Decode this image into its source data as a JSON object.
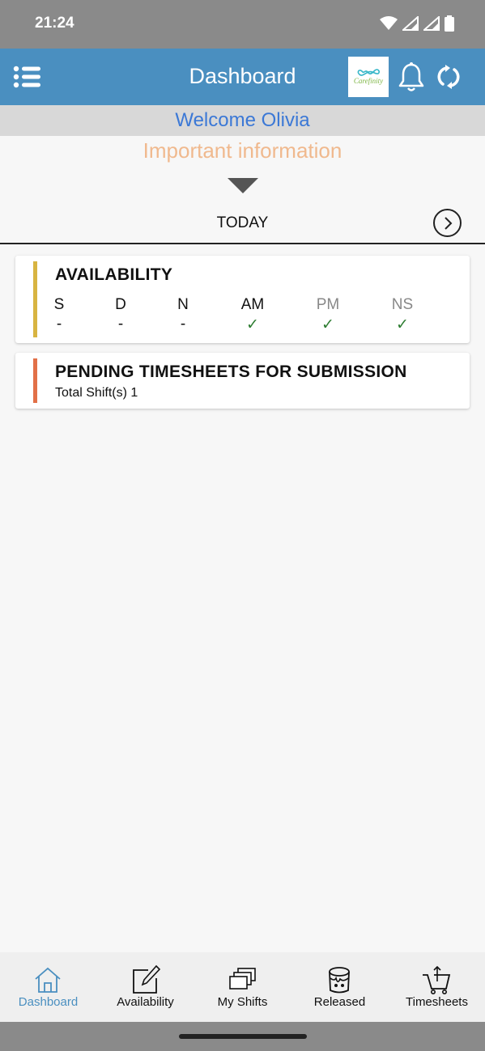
{
  "status_bar": {
    "time": "21:24"
  },
  "header": {
    "title": "Dashboard",
    "logo_text": "Carefinity"
  },
  "welcome": "Welcome Olivia",
  "important_info": "Important information",
  "today": "TODAY",
  "availability": {
    "title": "AVAILABILITY",
    "bar_color": "#d8b441",
    "columns": [
      {
        "label": "S",
        "value": "-"
      },
      {
        "label": "D",
        "value": "-"
      },
      {
        "label": "N",
        "value": "-"
      },
      {
        "label": "AM",
        "value": "✓"
      },
      {
        "label": "PM",
        "value": "✓"
      },
      {
        "label": "NS",
        "value": "✓"
      }
    ]
  },
  "pending": {
    "title": "PENDING TIMESHEETS FOR SUBMISSION",
    "subtitle": "Total Shift(s) 1",
    "bar_color": "#e27048"
  },
  "bottom_nav": [
    {
      "label": "Dashboard",
      "icon": "home-icon",
      "active": true
    },
    {
      "label": "Availability",
      "icon": "edit-icon",
      "active": false
    },
    {
      "label": "My Shifts",
      "icon": "stacked-pages-icon",
      "active": false
    },
    {
      "label": "Released",
      "icon": "paint-bucket-icon",
      "active": false
    },
    {
      "label": "Timesheets",
      "icon": "cart-icon",
      "active": false
    }
  ],
  "colors": {
    "header": "#4a8fc0",
    "welcome": "#3b78d6",
    "important": "#f0b98e",
    "check": "#2e7d32"
  }
}
